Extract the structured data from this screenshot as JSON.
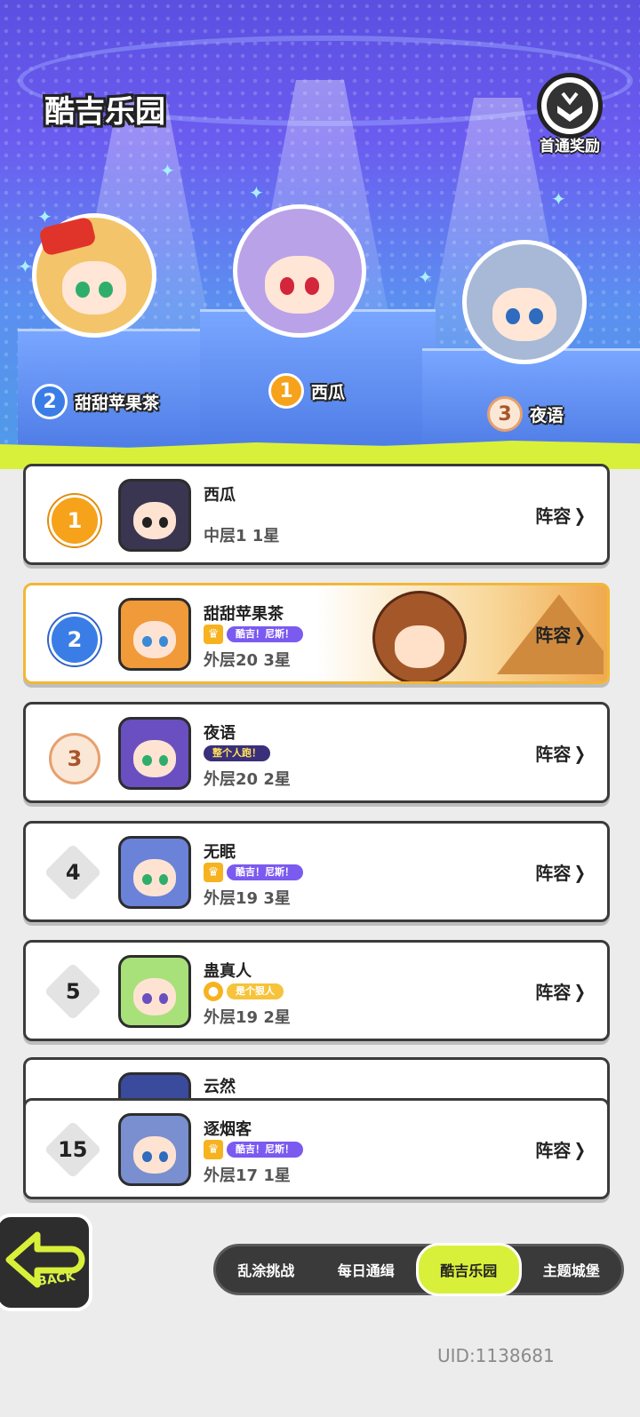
{
  "header": {
    "title": "酷吉乐园",
    "first_clear_reward": "首通奖励"
  },
  "podium": [
    {
      "rank": "2",
      "name": "甜甜苹果茶"
    },
    {
      "rank": "1",
      "name": "西瓜"
    },
    {
      "rank": "3",
      "name": "夜语"
    }
  ],
  "leaderboard": [
    {
      "rank": "1",
      "name": "西瓜",
      "title": "",
      "progress": "中层1 1星",
      "action": "阵容"
    },
    {
      "rank": "2",
      "name": "甜甜苹果茶",
      "title": "酷吉！尼斯！",
      "progress": "外层20 3星",
      "action": "阵容"
    },
    {
      "rank": "3",
      "name": "夜语",
      "title": "整个人跑！",
      "progress": "外层20 2星",
      "action": "阵容"
    },
    {
      "rank": "4",
      "name": "无眠",
      "title": "酷吉！尼斯！",
      "progress": "外层19 3星",
      "action": "阵容"
    },
    {
      "rank": "5",
      "name": "蛊真人",
      "title": "是个狠人",
      "progress": "外层19 2星",
      "action": "阵容"
    },
    {
      "rank": "",
      "name": "云然",
      "title": "",
      "progress": "",
      "action": ""
    }
  ],
  "self_row": {
    "rank": "15",
    "name": "逐烟客",
    "title": "酷吉！尼斯！",
    "progress": "外层17 1星",
    "action": "阵容"
  },
  "footer": {
    "back_label": "BACK",
    "tabs": [
      "乱涂挑战",
      "每日通缉",
      "酷吉乐园",
      "主题城堡"
    ],
    "active_tab": "酷吉乐园",
    "uid": "UID:1138681"
  },
  "colors": {
    "accent_lime": "#d9f03a",
    "rank_gold": "#f6a21b",
    "rank_blue": "#3a7de6",
    "highlight_border": "#f2b736"
  }
}
